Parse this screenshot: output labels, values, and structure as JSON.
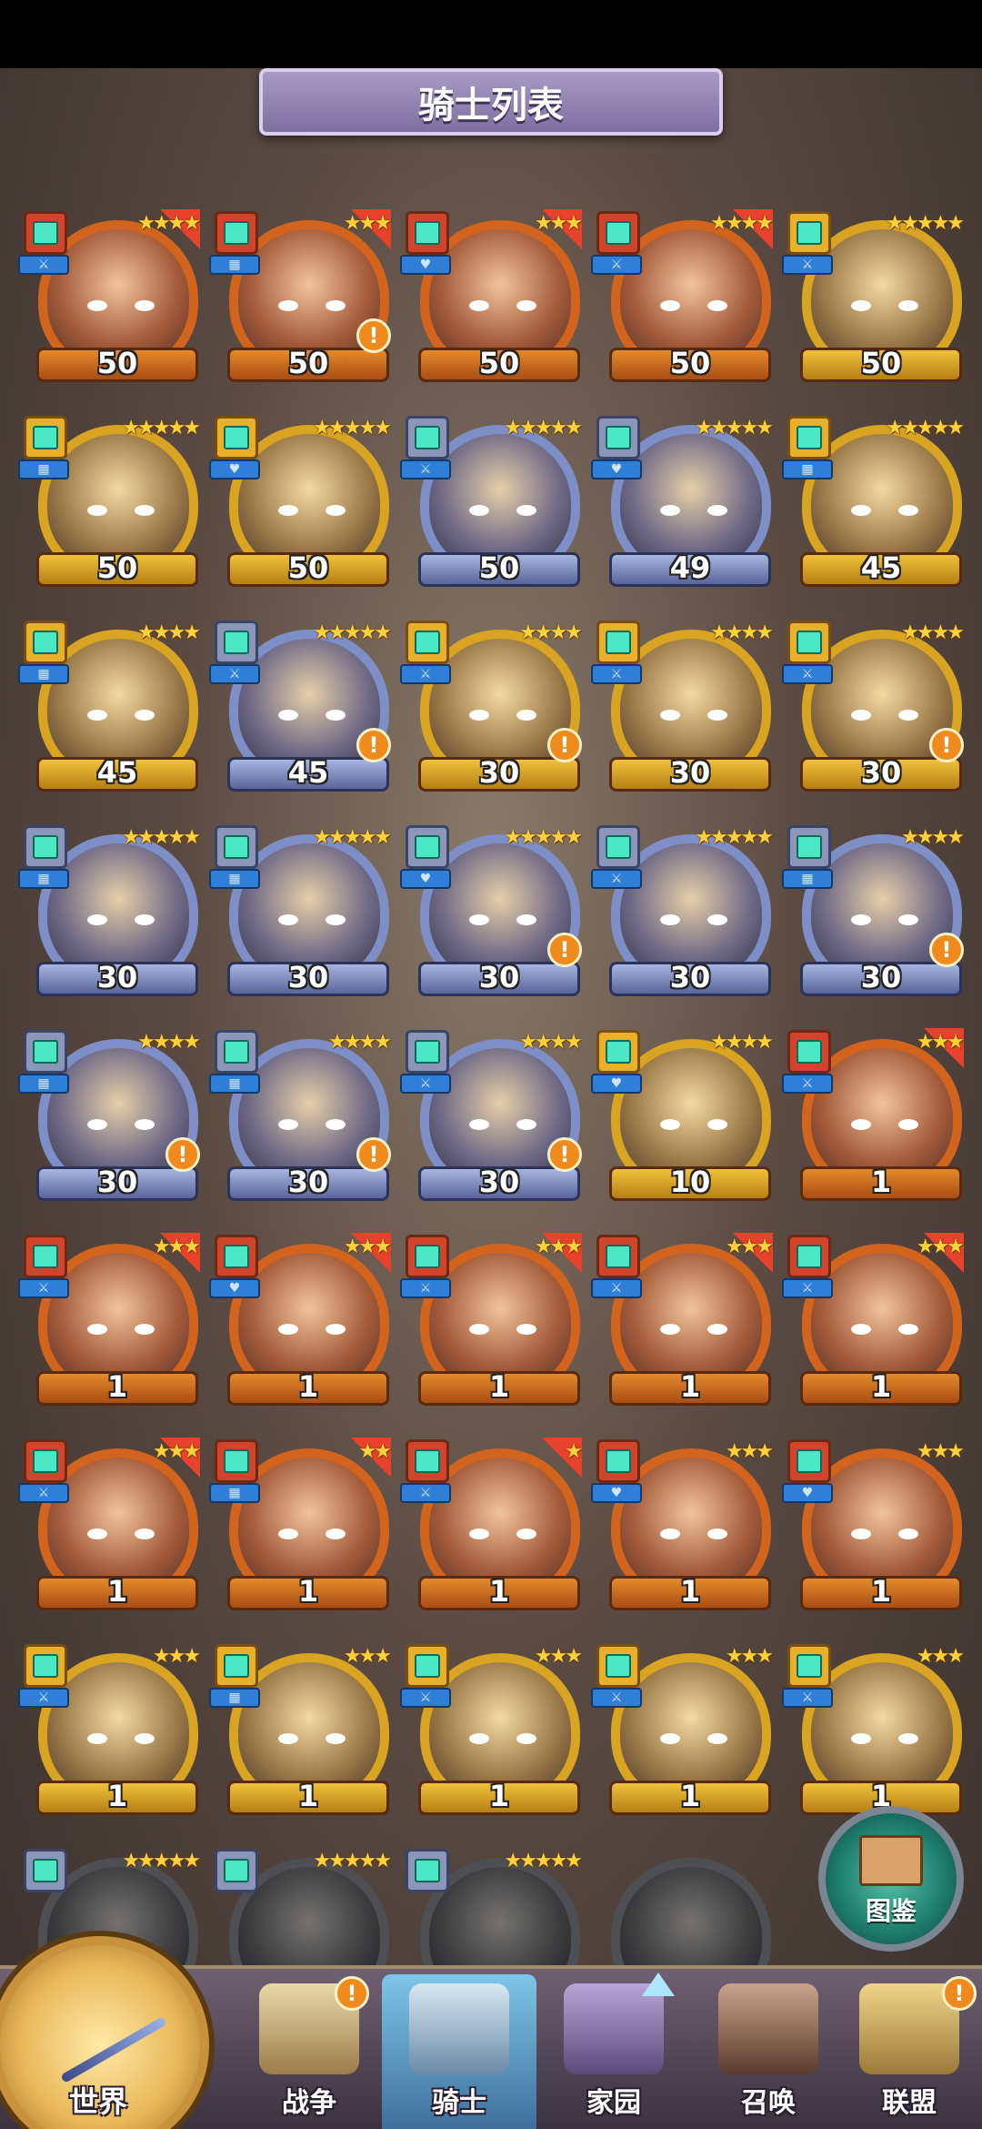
{
  "screen": {
    "title": "骑士列表"
  },
  "knights": [
    {
      "level": "50",
      "stars": "★★★★",
      "frame": "orange",
      "class": "red",
      "role": "⚔",
      "evolve": true,
      "alert": false
    },
    {
      "level": "50",
      "stars": "★★★",
      "frame": "orange",
      "class": "red",
      "role": "▦",
      "evolve": true,
      "alert": true
    },
    {
      "level": "50",
      "stars": "★★★",
      "frame": "orange",
      "class": "red",
      "role": "♥",
      "evolve": true,
      "alert": false
    },
    {
      "level": "50",
      "stars": "★★★★",
      "frame": "orange",
      "class": "red",
      "role": "⚔",
      "evolve": true,
      "alert": false
    },
    {
      "level": "50",
      "stars": "★★★★★",
      "frame": "gold",
      "class": "gold",
      "role": "⚔",
      "evolve": false,
      "alert": false
    },
    {
      "level": "50",
      "stars": "★★★★★",
      "frame": "gold",
      "class": "gold",
      "role": "▦",
      "evolve": false,
      "alert": false
    },
    {
      "level": "50",
      "stars": "★★★★★",
      "frame": "gold",
      "class": "gold",
      "role": "♥",
      "evolve": false,
      "alert": false
    },
    {
      "level": "50",
      "stars": "★★★★★",
      "frame": "blue",
      "class": "gray",
      "role": "⚔",
      "evolve": false,
      "alert": false
    },
    {
      "level": "49",
      "stars": "★★★★★",
      "frame": "blue",
      "class": "gray",
      "role": "♥",
      "evolve": false,
      "alert": false
    },
    {
      "level": "45",
      "stars": "★★★★★",
      "frame": "gold",
      "class": "gold",
      "role": "▦",
      "evolve": false,
      "alert": false
    },
    {
      "level": "45",
      "stars": "★★★★",
      "frame": "gold",
      "class": "gold",
      "role": "▦",
      "evolve": false,
      "alert": false
    },
    {
      "level": "45",
      "stars": "★★★★★",
      "frame": "blue",
      "class": "gray",
      "role": "⚔",
      "evolve": false,
      "alert": true
    },
    {
      "level": "30",
      "stars": "★★★★",
      "frame": "gold",
      "class": "gold",
      "role": "⚔",
      "evolve": false,
      "alert": true
    },
    {
      "level": "30",
      "stars": "★★★★",
      "frame": "gold",
      "class": "gold",
      "role": "⚔",
      "evolve": false,
      "alert": false
    },
    {
      "level": "30",
      "stars": "★★★★",
      "frame": "gold",
      "class": "gold",
      "role": "⚔",
      "evolve": false,
      "alert": true
    },
    {
      "level": "30",
      "stars": "★★★★★",
      "frame": "blue",
      "class": "gray",
      "role": "▦",
      "evolve": false,
      "alert": false
    },
    {
      "level": "30",
      "stars": "★★★★★",
      "frame": "blue",
      "class": "gray",
      "role": "▦",
      "evolve": false,
      "alert": false
    },
    {
      "level": "30",
      "stars": "★★★★★",
      "frame": "blue",
      "class": "gray",
      "role": "♥",
      "evolve": false,
      "alert": true
    },
    {
      "level": "30",
      "stars": "★★★★★",
      "frame": "blue",
      "class": "gray",
      "role": "⚔",
      "evolve": false,
      "alert": false
    },
    {
      "level": "30",
      "stars": "★★★★",
      "frame": "blue",
      "class": "gray",
      "role": "▦",
      "evolve": false,
      "alert": true
    },
    {
      "level": "30",
      "stars": "★★★★",
      "frame": "blue",
      "class": "gray",
      "role": "▦",
      "evolve": false,
      "alert": true
    },
    {
      "level": "30",
      "stars": "★★★★",
      "frame": "blue",
      "class": "gray",
      "role": "▦",
      "evolve": false,
      "alert": true
    },
    {
      "level": "30",
      "stars": "★★★★",
      "frame": "blue",
      "class": "gray",
      "role": "⚔",
      "evolve": false,
      "alert": true
    },
    {
      "level": "10",
      "stars": "★★★★",
      "frame": "gold",
      "class": "gold",
      "role": "♥",
      "evolve": false,
      "alert": false
    },
    {
      "level": "1",
      "stars": "★★★",
      "frame": "orange",
      "class": "red",
      "role": "⚔",
      "evolve": true,
      "alert": false
    },
    {
      "level": "1",
      "stars": "★★★",
      "frame": "orange",
      "class": "red",
      "role": "⚔",
      "evolve": true,
      "alert": false
    },
    {
      "level": "1",
      "stars": "★★★",
      "frame": "orange",
      "class": "red",
      "role": "♥",
      "evolve": true,
      "alert": false
    },
    {
      "level": "1",
      "stars": "★★★",
      "frame": "orange",
      "class": "red",
      "role": "⚔",
      "evolve": true,
      "alert": false
    },
    {
      "level": "1",
      "stars": "★★★",
      "frame": "orange",
      "class": "red",
      "role": "⚔",
      "evolve": true,
      "alert": false
    },
    {
      "level": "1",
      "stars": "★★★",
      "frame": "orange",
      "class": "red",
      "role": "⚔",
      "evolve": true,
      "alert": false
    },
    {
      "level": "1",
      "stars": "★★★",
      "frame": "orange",
      "class": "red",
      "role": "⚔",
      "evolve": true,
      "alert": false
    },
    {
      "level": "1",
      "stars": "★★",
      "frame": "orange",
      "class": "red",
      "role": "▦",
      "evolve": true,
      "alert": false
    },
    {
      "level": "1",
      "stars": "★",
      "frame": "orange",
      "class": "red",
      "role": "⚔",
      "evolve": true,
      "alert": false
    },
    {
      "level": "1",
      "stars": "★★★",
      "frame": "orange",
      "class": "red",
      "role": "♥",
      "evolve": false,
      "alert": false
    },
    {
      "level": "1",
      "stars": "★★★",
      "frame": "orange",
      "class": "red",
      "role": "♥",
      "evolve": false,
      "alert": false
    },
    {
      "level": "1",
      "stars": "★★★",
      "frame": "gold",
      "class": "gold",
      "role": "⚔",
      "evolve": false,
      "alert": false
    },
    {
      "level": "1",
      "stars": "★★★",
      "frame": "gold",
      "class": "gold",
      "role": "▦",
      "evolve": false,
      "alert": false
    },
    {
      "level": "1",
      "stars": "★★★",
      "frame": "gold",
      "class": "gold",
      "role": "⚔",
      "evolve": false,
      "alert": false
    },
    {
      "level": "1",
      "stars": "★★★",
      "frame": "gold",
      "class": "gold",
      "role": "⚔",
      "evolve": false,
      "alert": false
    },
    {
      "level": "1",
      "stars": "★★★",
      "frame": "gold",
      "class": "gold",
      "role": "⚔",
      "evolve": false,
      "alert": false
    }
  ],
  "locked_row": [
    {
      "stars": "★★★★★",
      "class": "gray",
      "role": "▦"
    },
    {
      "stars": "★★★★★",
      "class": "gray",
      "role": "⚔"
    },
    {
      "stars": "★★★★★",
      "class": "gray",
      "role": "⚔"
    },
    {
      "stars": "",
      "class": "gray",
      "role": ""
    }
  ],
  "compendium": {
    "label": "图鉴",
    "icon": "book-icon"
  },
  "nav": {
    "world": "世界",
    "war": "战争",
    "knight": "骑士",
    "home": "家园",
    "summon": "召唤",
    "alliance": "联盟",
    "badge": "!"
  },
  "colors": {
    "alert": "#f08a1c",
    "evolve": "#e8412c",
    "frame_orange": "#d2641e",
    "frame_gold": "#d9a421",
    "frame_blue": "#7d8fc6"
  }
}
